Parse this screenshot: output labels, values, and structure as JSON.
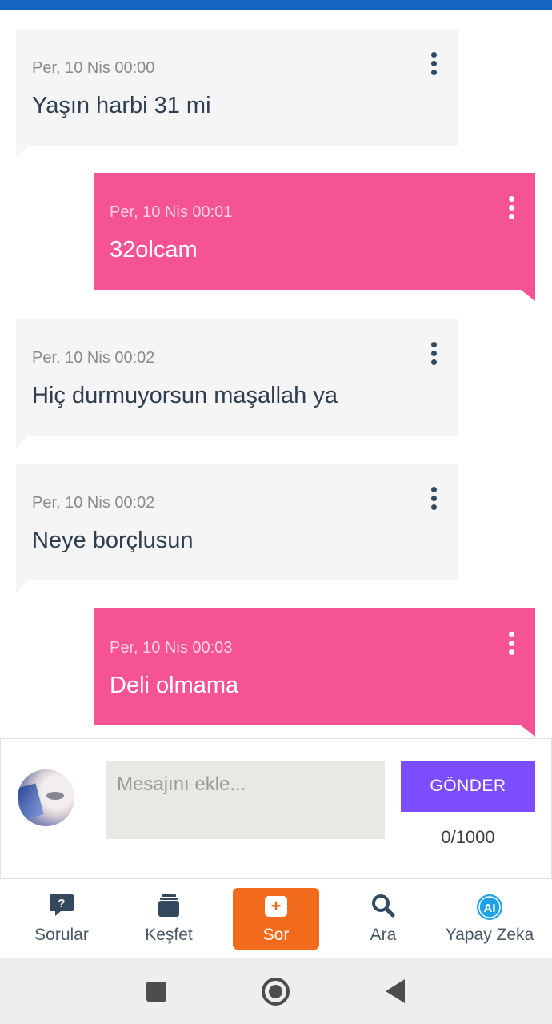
{
  "messages": [
    {
      "direction": "incoming",
      "time": "Per, 10 Nis 00:00",
      "text": "Yaşın harbi 31 mi"
    },
    {
      "direction": "outgoing",
      "time": "Per, 10 Nis 00:01",
      "text": "32olcam"
    },
    {
      "direction": "incoming",
      "time": "Per, 10 Nis 00:02",
      "text": "Hiç durmuyorsun maşallah ya"
    },
    {
      "direction": "incoming",
      "time": "Per, 10 Nis 00:02",
      "text": "Neye borçlusun"
    },
    {
      "direction": "outgoing",
      "time": "Per, 10 Nis 00:03",
      "text": "Deli olmama"
    }
  ],
  "composer": {
    "placeholder": "Mesajını ekle...",
    "value": "",
    "send_label": "GÖNDER",
    "counter": "0/1000"
  },
  "bottom_nav": {
    "sorular": "Sorular",
    "kesfet": "Keşfet",
    "sor": "Sor",
    "ara": "Ara",
    "yapay_zeka": "Yapay Zeka",
    "ai_badge": "AI"
  },
  "colors": {
    "incoming_bubble": "#f5f5f5",
    "outgoing_bubble": "#f55393",
    "send_button": "#7c4dff",
    "sor_button": "#f26a1b",
    "top_bar": "#1565c0"
  }
}
